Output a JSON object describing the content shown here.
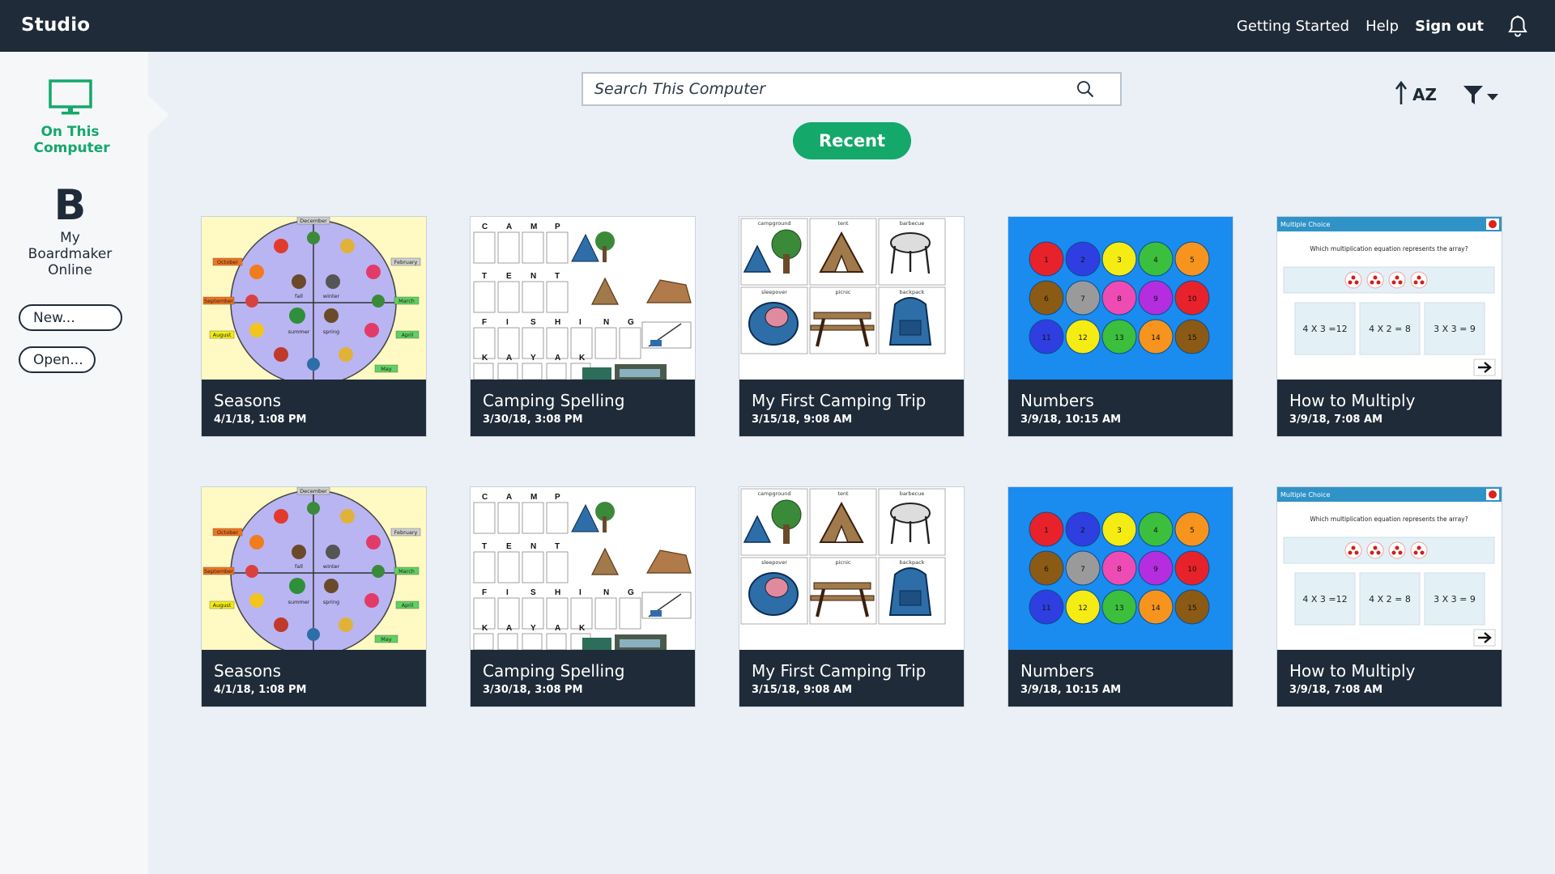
{
  "app": {
    "title": "Studio"
  },
  "topnav": {
    "getting_started": "Getting Started",
    "help": "Help",
    "sign_out": "Sign out"
  },
  "sidebar": {
    "on_this_computer": "On This Computer",
    "boardmaker_logo": "B",
    "my_boardmaker_online": "My Boardmaker Online",
    "new_button": "New...",
    "open_button": "Open..."
  },
  "search": {
    "placeholder": "Search This Computer"
  },
  "recent_button": "Recent",
  "sort": {
    "label": "AZ"
  },
  "colors": {
    "accent": "#14a86b",
    "topbar": "#1f2b38",
    "background": "#eaf0f6"
  },
  "activities": [
    {
      "title": "Seasons",
      "date": "4/1/18, 1:08 PM",
      "thumb": "seasons"
    },
    {
      "title": "Camping Spelling",
      "date": "3/30/18, 3:08 PM",
      "thumb": "spelling"
    },
    {
      "title": "My First Camping Trip",
      "date": "3/15/18, 9:08 AM",
      "thumb": "camping"
    },
    {
      "title": "Numbers",
      "date": "3/9/18, 10:15 AM",
      "thumb": "numbers"
    },
    {
      "title": "How to Multiply",
      "date": "3/9/18, 7:08 AM",
      "thumb": "multiply"
    },
    {
      "title": "Seasons",
      "date": "4/1/18, 1:08 PM",
      "thumb": "seasons"
    },
    {
      "title": "Camping Spelling",
      "date": "3/30/18, 3:08 PM",
      "thumb": "spelling"
    },
    {
      "title": "My First Camping Trip",
      "date": "3/15/18, 9:08 AM",
      "thumb": "camping"
    },
    {
      "title": "Numbers",
      "date": "3/9/18, 10:15 AM",
      "thumb": "numbers"
    },
    {
      "title": "How to Multiply",
      "date": "3/9/18, 7:08 AM",
      "thumb": "multiply"
    }
  ],
  "thumb_content": {
    "seasons": {
      "months": [
        "December",
        "October",
        "February",
        "September",
        "March",
        "August",
        "April",
        "May"
      ],
      "seasons": [
        "fall",
        "winter",
        "summer",
        "spring"
      ]
    },
    "spelling": {
      "words": [
        "CAMP",
        "TENT",
        "FISHING",
        "KAYAK"
      ]
    },
    "camping": {
      "labels": [
        "campground",
        "tent",
        "barbecue",
        "sleepover",
        "picnic",
        "backpack"
      ]
    },
    "numbers": {
      "values": [
        "1",
        "2",
        "3",
        "4",
        "5",
        "6",
        "7",
        "8",
        "9",
        "10",
        "11",
        "12",
        "13",
        "14",
        "15"
      ],
      "colors": [
        "#e8222a",
        "#2e3ee0",
        "#f4ec12",
        "#3cbf3c",
        "#f7941d",
        "#8b5a14",
        "#9a9a9a",
        "#ee4bb4",
        "#b42ee0",
        "#e8222a",
        "#2e3ee0",
        "#f4ec12",
        "#3cbf3c",
        "#f7941d",
        "#8b5a14"
      ]
    },
    "multiply": {
      "header": "Multiple Choice",
      "question": "Which multiplication equation represents the array?",
      "choices": [
        "4 X 3 =12",
        "4 X 2 = 8",
        "3 X 3 = 9"
      ]
    }
  }
}
